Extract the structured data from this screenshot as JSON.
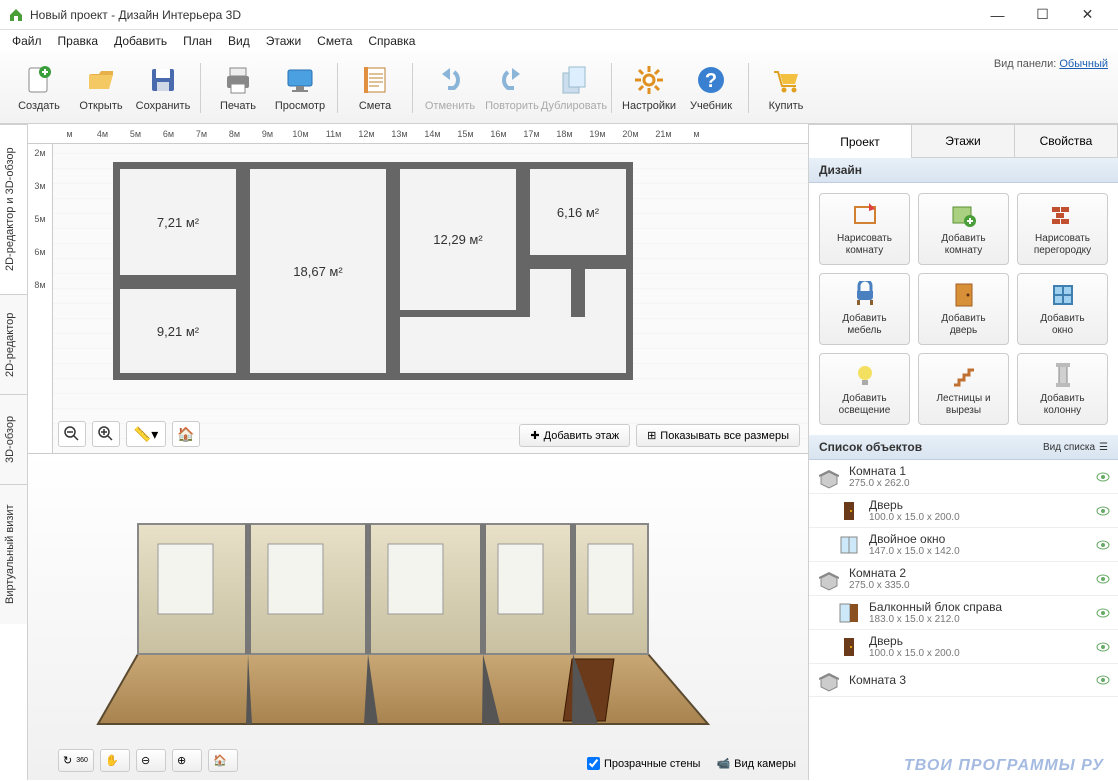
{
  "titlebar": {
    "title": "Новый проект - Дизайн Интерьера 3D"
  },
  "menu": [
    "Файл",
    "Правка",
    "Добавить",
    "План",
    "Вид",
    "Этажи",
    "Смета",
    "Справка"
  ],
  "panel_mode": {
    "label": "Вид панели:",
    "value": "Обычный"
  },
  "toolbar": [
    {
      "id": "new",
      "label": "Создать",
      "group": 0,
      "enabled": true
    },
    {
      "id": "open",
      "label": "Открыть",
      "group": 0,
      "enabled": true
    },
    {
      "id": "save",
      "label": "Сохранить",
      "group": 0,
      "enabled": true
    },
    {
      "id": "print",
      "label": "Печать",
      "group": 1,
      "enabled": true
    },
    {
      "id": "preview",
      "label": "Просмотр",
      "group": 1,
      "enabled": true
    },
    {
      "id": "estimate",
      "label": "Смета",
      "group": 2,
      "enabled": true
    },
    {
      "id": "undo",
      "label": "Отменить",
      "group": 3,
      "enabled": false
    },
    {
      "id": "redo",
      "label": "Повторить",
      "group": 3,
      "enabled": false
    },
    {
      "id": "duplicate",
      "label": "Дублировать",
      "group": 3,
      "enabled": false
    },
    {
      "id": "settings",
      "label": "Настройки",
      "group": 4,
      "enabled": true
    },
    {
      "id": "manual",
      "label": "Учебник",
      "group": 4,
      "enabled": true
    },
    {
      "id": "buy",
      "label": "Купить",
      "group": 5,
      "enabled": true
    }
  ],
  "side_tabs": [
    "2D-редактор и 3D-обзор",
    "2D-редактор",
    "3D-обзор",
    "Виртуальный визит"
  ],
  "ruler_h": [
    "м",
    "4м",
    "5м",
    "6м",
    "7м",
    "8м",
    "9м",
    "10м",
    "11м",
    "12м",
    "13м",
    "14м",
    "15м",
    "16м",
    "17м",
    "18м",
    "19м",
    "20м",
    "21м",
    "м"
  ],
  "ruler_v": [
    "2м",
    "3м",
    "5м",
    "6м",
    "8м"
  ],
  "rooms": [
    {
      "area": "7,21 м²"
    },
    {
      "area": "18,67 м²"
    },
    {
      "area": "12,29 м²"
    },
    {
      "area": "6,16 м²"
    },
    {
      "area": "9,21 м²"
    }
  ],
  "plan_buttons": {
    "add_floor": "Добавить этаж",
    "show_dims": "Показывать все размеры"
  },
  "view3d_opts": {
    "transparent": "Прозрачные стены",
    "camera": "Вид камеры"
  },
  "right_tabs": [
    "Проект",
    "Этажи",
    "Свойства"
  ],
  "design_header": "Дизайн",
  "design_buttons": [
    {
      "id": "draw-room",
      "l1": "Нарисовать",
      "l2": "комнату"
    },
    {
      "id": "add-room",
      "l1": "Добавить",
      "l2": "комнату"
    },
    {
      "id": "draw-partition",
      "l1": "Нарисовать",
      "l2": "перегородку"
    },
    {
      "id": "add-furniture",
      "l1": "Добавить",
      "l2": "мебель"
    },
    {
      "id": "add-door",
      "l1": "Добавить",
      "l2": "дверь"
    },
    {
      "id": "add-window",
      "l1": "Добавить",
      "l2": "окно"
    },
    {
      "id": "add-light",
      "l1": "Добавить",
      "l2": "освещение"
    },
    {
      "id": "stairs",
      "l1": "Лестницы и",
      "l2": "вырезы"
    },
    {
      "id": "add-column",
      "l1": "Добавить",
      "l2": "колонну"
    }
  ],
  "objects_header": "Список объектов",
  "list_view_label": "Вид списка",
  "objects": [
    {
      "name": "Комната 1",
      "dim": "275.0 x 262.0",
      "type": "room",
      "child": false
    },
    {
      "name": "Дверь",
      "dim": "100.0 x 15.0 x 200.0",
      "type": "door",
      "child": true
    },
    {
      "name": "Двойное окно",
      "dim": "147.0 x 15.0 x 142.0",
      "type": "window",
      "child": true
    },
    {
      "name": "Комната 2",
      "dim": "275.0 x 335.0",
      "type": "room",
      "child": false
    },
    {
      "name": "Балконный блок справа",
      "dim": "183.0 x 15.0 x 212.0",
      "type": "balcony",
      "child": true
    },
    {
      "name": "Дверь",
      "dim": "100.0 x 15.0 x 200.0",
      "type": "door",
      "child": true
    },
    {
      "name": "Комната 3",
      "dim": "",
      "type": "room",
      "child": false
    }
  ],
  "watermark": "ТВОИ ПРОГРАММЫ РУ"
}
